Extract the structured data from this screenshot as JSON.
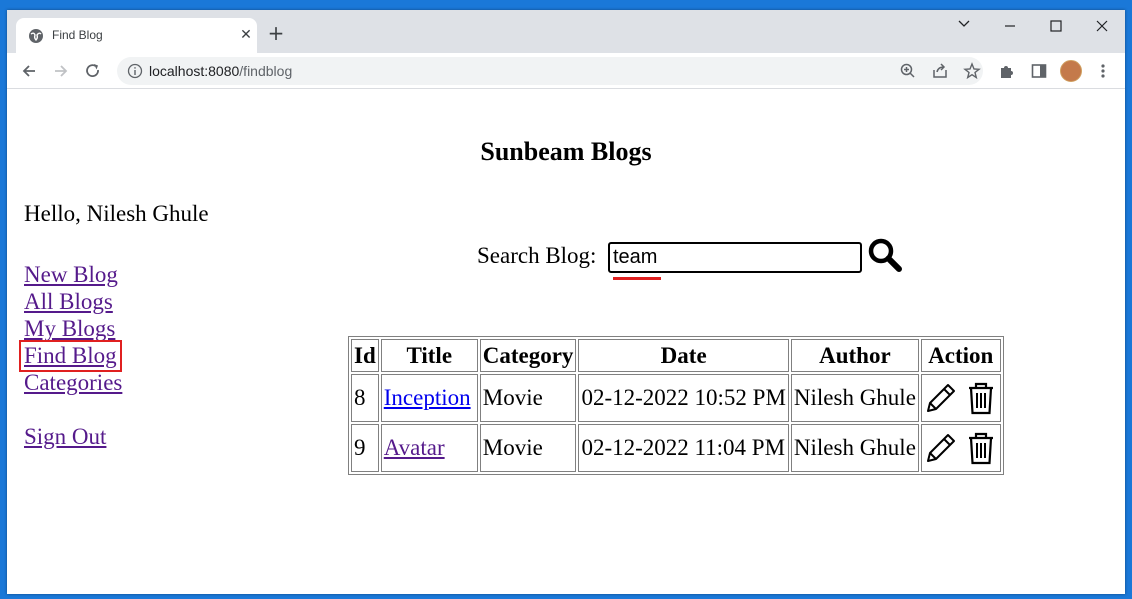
{
  "browser": {
    "tab_title": "Find Blog",
    "url_host": "localhost:8080",
    "url_path": "/findblog"
  },
  "page": {
    "title": "Sunbeam Blogs",
    "greeting": "Hello, Nilesh Ghule",
    "nav": {
      "new_blog": "New Blog",
      "all_blogs": "All Blogs",
      "my_blogs": "My Blogs",
      "find_blog": "Find Blog",
      "categories": "Categories",
      "sign_out": "Sign Out"
    },
    "search": {
      "label": "Search Blog:",
      "value": "team"
    },
    "table": {
      "headers": [
        "Id",
        "Title",
        "Category",
        "Date",
        "Author",
        "Action"
      ],
      "rows": [
        {
          "id": "8",
          "title": "Inception",
          "category": "Movie",
          "date": "02-12-2022 10:52 PM",
          "author": "Nilesh Ghule",
          "title_color": "#0000ee"
        },
        {
          "id": "9",
          "title": "Avatar",
          "category": "Movie",
          "date": "02-12-2022 11:04 PM",
          "author": "Nilesh Ghule",
          "title_color": "#551a8b"
        }
      ]
    }
  },
  "colors": {
    "visited_link": "#551a8b",
    "unvisited_link": "#0000ee",
    "active_outline": "#e02020",
    "desktop": "#1a78d8"
  }
}
